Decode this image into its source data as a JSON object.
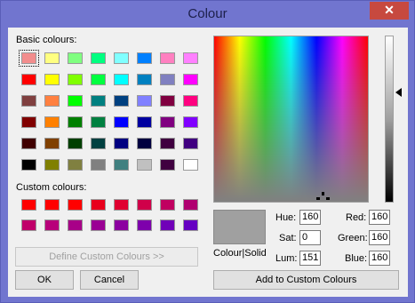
{
  "window": {
    "title": "Colour",
    "close_glyph": "✕"
  },
  "labels": {
    "basic": "Basic colours:",
    "custom": "Custom colours:",
    "solid": "Colour|Solid"
  },
  "basic_colours": [
    "#f28d8d",
    "#ffff80",
    "#80ff80",
    "#00ff80",
    "#80ffff",
    "#0080ff",
    "#ff80c0",
    "#ff80ff",
    "#ff0000",
    "#ffff00",
    "#80ff00",
    "#00ff40",
    "#00ffff",
    "#0080c0",
    "#8080c0",
    "#ff00ff",
    "#804040",
    "#ff8040",
    "#00ff00",
    "#008080",
    "#004080",
    "#8080ff",
    "#800040",
    "#ff0080",
    "#800000",
    "#ff8000",
    "#008000",
    "#008040",
    "#0000ff",
    "#0000a0",
    "#800080",
    "#8000ff",
    "#400000",
    "#804000",
    "#004000",
    "#004040",
    "#000080",
    "#000040",
    "#400040",
    "#400080",
    "#000000",
    "#808000",
    "#808040",
    "#808080",
    "#408080",
    "#c0c0c0",
    "#400040",
    "#ffffff"
  ],
  "custom_colours": [
    "#ff0000",
    "#ff0000",
    "#ff0000",
    "#e8001c",
    "#e00030",
    "#d0004a",
    "#c00060",
    "#b00070",
    "#c0006a",
    "#b8007a",
    "#a80088",
    "#9a0094",
    "#8c00a0",
    "#7e00ac",
    "#7000b8",
    "#6600c2"
  ],
  "buttons": {
    "define": "Define Custom Colours >>",
    "ok": "OK",
    "cancel": "Cancel",
    "add": "Add to Custom Colours"
  },
  "fields": {
    "hue": {
      "label": "Hue:",
      "value": "160"
    },
    "sat": {
      "label": "Sat:",
      "value": "0"
    },
    "lum": {
      "label": "Lum:",
      "value": "151"
    },
    "red": {
      "label": "Red:",
      "value": "160"
    },
    "green": {
      "label": "Green:",
      "value": "160"
    },
    "blue": {
      "label": "Blue:",
      "value": "160"
    }
  },
  "current_colour": "#a0a0a0",
  "luminance_level": 0.34,
  "icons": {
    "close": "close-icon",
    "crosshair": "crosshair-icon",
    "lum_arrow": "luminance-arrow-icon"
  }
}
